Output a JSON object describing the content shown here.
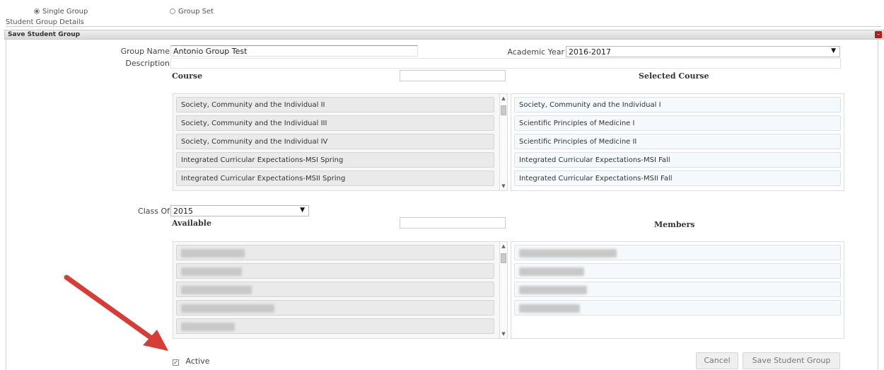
{
  "top": {
    "single_group": "Single Group",
    "group_set": "Group Set",
    "details_label": "Student Group Details"
  },
  "panel": {
    "title": "Save Student Group"
  },
  "form": {
    "group_name_label": "Group Name",
    "group_name_value": "Antonio Group Test",
    "description_label": "Description",
    "description_value": "",
    "academic_year_label": "Academic Year",
    "academic_year_value": "2016-2017",
    "course_heading": "Course",
    "course_filter_value": "",
    "selected_course_heading": "Selected Course",
    "class_of_label": "Class Of",
    "class_of_value": "2015",
    "available_heading": "Available",
    "available_filter_value": "",
    "members_heading": "Members",
    "active_label": "Active",
    "active_checked": true
  },
  "courses_available": [
    "Society, Community and the Individual II",
    "Society, Community and the Individual III",
    "Society, Community and the Individual IV",
    "Integrated Curricular Expectations-MSI Spring",
    "Integrated Curricular Expectations-MSII Spring"
  ],
  "courses_selected": [
    "Society, Community and the Individual I",
    "Scientific Principles of Medicine I",
    "Scientific Principles of Medicine II",
    "Integrated Curricular Expectations-MSI Fall",
    "Integrated Curricular Expectations-MSII Fall"
  ],
  "buttons": {
    "cancel": "Cancel",
    "save": "Save Student Group"
  }
}
